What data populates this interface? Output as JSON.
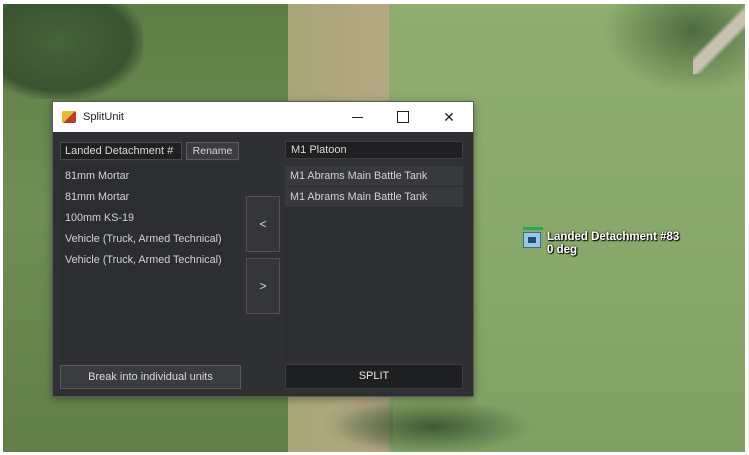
{
  "window": {
    "title": "SplitUnit",
    "min_glyph": "—",
    "close_glyph": "✕"
  },
  "left_panel": {
    "name_value": "Landed Detachment #",
    "rename_label": "Rename",
    "items": [
      "81mm Mortar",
      "81mm Mortar",
      "100mm KS-19",
      "Vehicle (Truck, Armed Technical)",
      "Vehicle (Truck, Armed Technical)"
    ],
    "break_label": "Break into individual units"
  },
  "transfer": {
    "move_left_label": "<",
    "move_right_label": ">"
  },
  "right_panel": {
    "name_value": "M1 Platoon",
    "items": [
      "M1 Abrams Main Battle Tank",
      "M1 Abrams Main Battle Tank"
    ],
    "split_label": "SPLIT"
  },
  "map_unit": {
    "name": "Landed Detachment #83",
    "heading": "0 deg",
    "bar_color": "#2aa84a",
    "icon_color": "#9dc6e6"
  }
}
